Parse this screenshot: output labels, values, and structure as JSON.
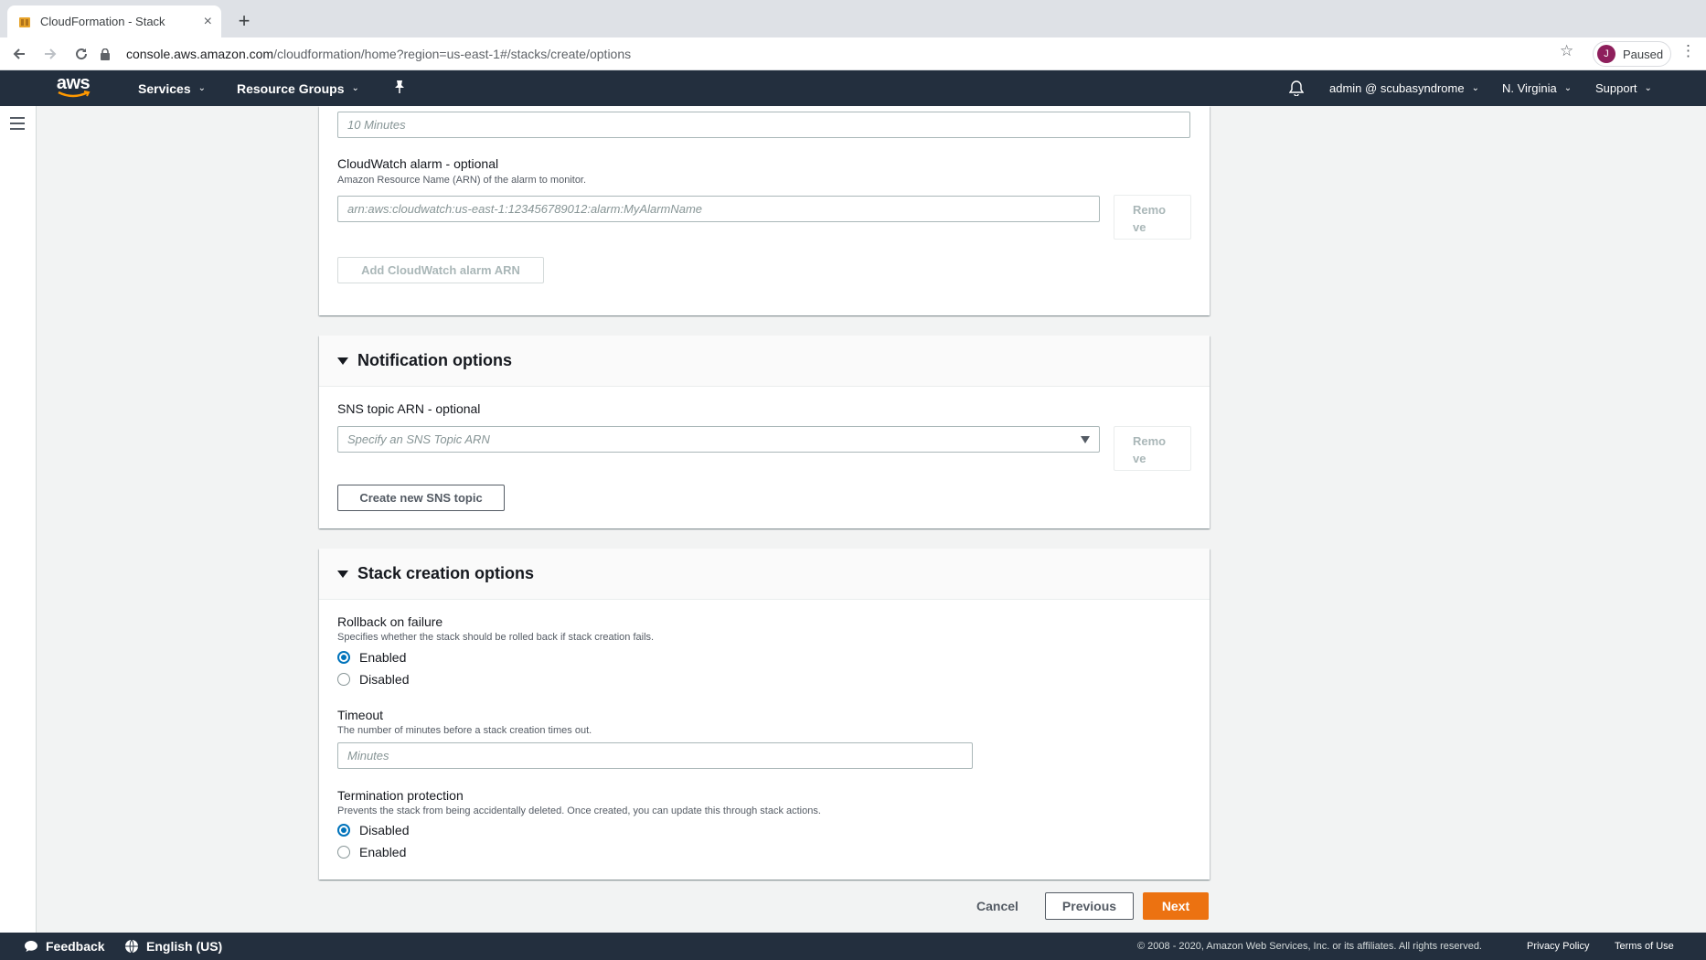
{
  "browser": {
    "tab_title": "CloudFormation - Stack",
    "url_host": "console.aws.amazon.com",
    "url_path": "/cloudformation/home?region=us-east-1#/stacks/create/options",
    "profile_initial": "J",
    "profile_status": "Paused"
  },
  "aws_nav": {
    "logo": "aws",
    "services": "Services",
    "resource_groups": "Resource Groups",
    "account": "admin @ scubasyndrome",
    "region": "N. Virginia",
    "support": "Support"
  },
  "monitoring": {
    "time_placeholder": "10 Minutes",
    "alarm_label": "CloudWatch alarm - optional",
    "alarm_desc": "Amazon Resource Name (ARN) of the alarm to monitor.",
    "alarm_placeholder": "arn:aws:cloudwatch:us-east-1:123456789012:alarm:MyAlarmName",
    "remove_line1": "Remo",
    "remove_line2": "ve",
    "add_alarm": "Add CloudWatch alarm ARN"
  },
  "notification": {
    "title": "Notification options",
    "sns_label": "SNS topic ARN - optional",
    "sns_placeholder": "Specify an SNS Topic ARN",
    "remove_line1": "Remo",
    "remove_line2": "ve",
    "create_topic": "Create new SNS topic"
  },
  "stack_creation": {
    "title": "Stack creation options",
    "rollback_label": "Rollback on failure",
    "rollback_desc": "Specifies whether the stack should be rolled back if stack creation fails.",
    "rollback_options": [
      "Enabled",
      "Disabled"
    ],
    "rollback_selected": "Enabled",
    "timeout_label": "Timeout",
    "timeout_desc": "The number of minutes before a stack creation times out.",
    "timeout_placeholder": "Minutes",
    "termination_label": "Termination protection",
    "termination_desc": "Prevents the stack from being accidentally deleted. Once created, you can update this through stack actions.",
    "termination_options": [
      "Disabled",
      "Enabled"
    ],
    "termination_selected": "Disabled"
  },
  "actions": {
    "cancel": "Cancel",
    "previous": "Previous",
    "next": "Next"
  },
  "footer": {
    "feedback": "Feedback",
    "language": "English (US)",
    "copyright": "© 2008 - 2020, Amazon Web Services, Inc. or its affiliates. All rights reserved.",
    "privacy": "Privacy Policy",
    "terms": "Terms of Use"
  },
  "colors": {
    "nav_bg": "#232f3e",
    "primary": "#ec7211",
    "radio": "#0073bb"
  }
}
